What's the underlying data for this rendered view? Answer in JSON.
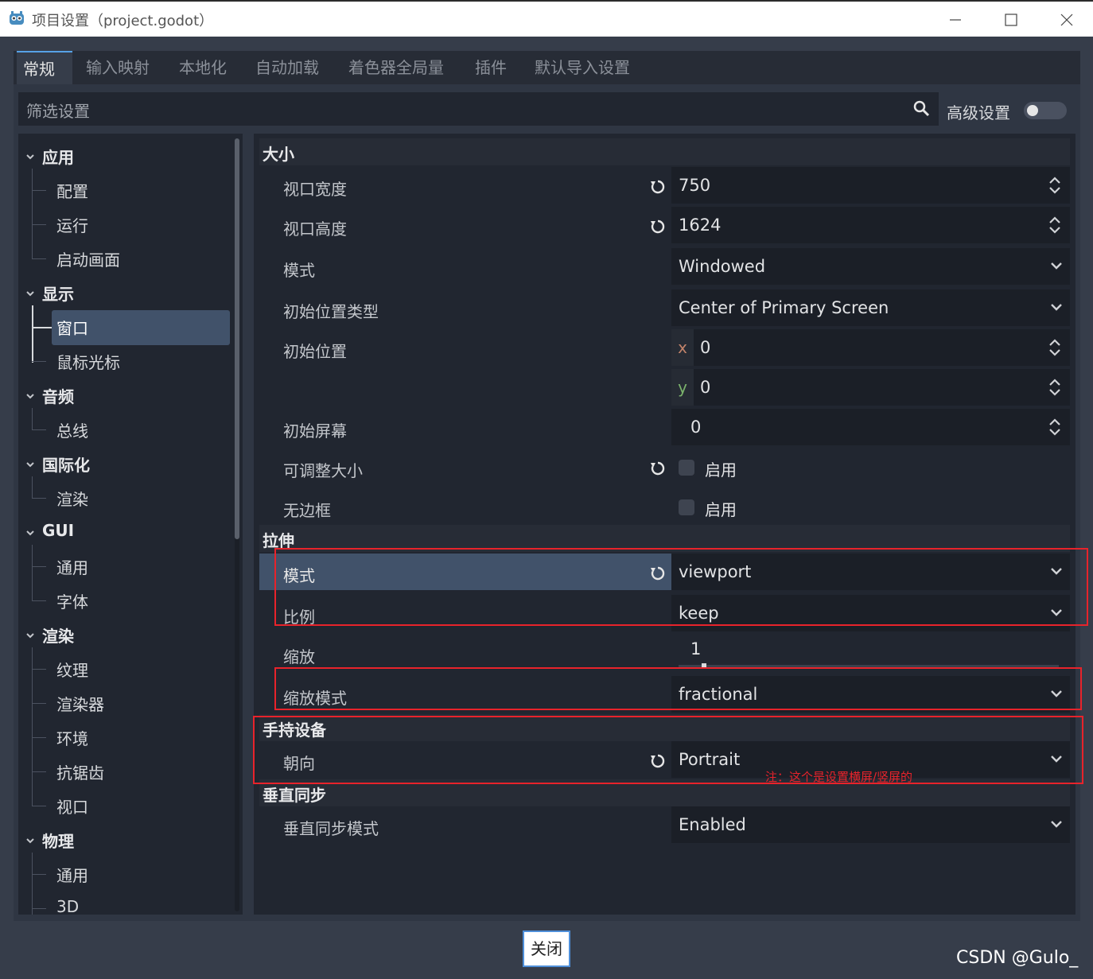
{
  "window": {
    "title": "项目设置（project.godot）"
  },
  "tabs": [
    "常规",
    "输入映射",
    "本地化",
    "自动加载",
    "着色器全局量",
    "插件",
    "默认导入设置"
  ],
  "filter": {
    "placeholder": "筛选设置",
    "advanced_label": "高级设置",
    "advanced_on": false
  },
  "sidebar": {
    "categories": [
      {
        "label": "应用",
        "items": [
          "配置",
          "运行",
          "启动画面"
        ]
      },
      {
        "label": "显示",
        "items": [
          "窗口",
          "鼠标光标"
        ]
      },
      {
        "label": "音频",
        "items": [
          "总线"
        ]
      },
      {
        "label": "国际化",
        "items": [
          "渲染"
        ]
      },
      {
        "label": "GUI",
        "items": [
          "通用",
          "字体"
        ]
      },
      {
        "label": "渲染",
        "items": [
          "纹理",
          "渲染器",
          "环境",
          "抗锯齿",
          "视口"
        ]
      },
      {
        "label": "物理",
        "items": [
          "通用",
          "3D"
        ]
      }
    ],
    "selected": "窗口"
  },
  "inspector": {
    "sections": {
      "size": "大小",
      "stretch": "拉伸",
      "handheld": "手持设备",
      "vsync": "垂直同步"
    },
    "rows": {
      "viewport_width": {
        "label": "视口宽度",
        "value": "750"
      },
      "viewport_height": {
        "label": "视口高度",
        "value": "1624"
      },
      "mode": {
        "label": "模式",
        "value": "Windowed"
      },
      "initial_position_type": {
        "label": "初始位置类型",
        "value": "Center of Primary Screen"
      },
      "initial_position": {
        "label": "初始位置",
        "x_axis": "x",
        "x": "0",
        "y_axis": "y",
        "y": "0"
      },
      "initial_screen": {
        "label": "初始屏幕",
        "value": "0"
      },
      "resizable": {
        "label": "可调整大小",
        "check_label": "启用",
        "checked": false
      },
      "borderless": {
        "label": "无边框",
        "check_label": "启用",
        "checked": false
      },
      "stretch_mode": {
        "label": "模式",
        "value": "viewport"
      },
      "stretch_aspect": {
        "label": "比例",
        "value": "keep"
      },
      "stretch_scale": {
        "label": "缩放",
        "value": "1"
      },
      "scale_mode": {
        "label": "缩放模式",
        "value": "fractional"
      },
      "orientation": {
        "label": "朝向",
        "value": "Portrait"
      },
      "vsync_mode": {
        "label": "垂直同步模式",
        "value": "Enabled"
      }
    },
    "annotation_note": "注：这个是设置横屏/竖屏的"
  },
  "footer": {
    "close_label": "关闭"
  },
  "watermark": "CSDN @Gulo_",
  "colors": {
    "accent": "#57a2e6",
    "selected": "#41526a",
    "annotation": "#e8232b"
  }
}
